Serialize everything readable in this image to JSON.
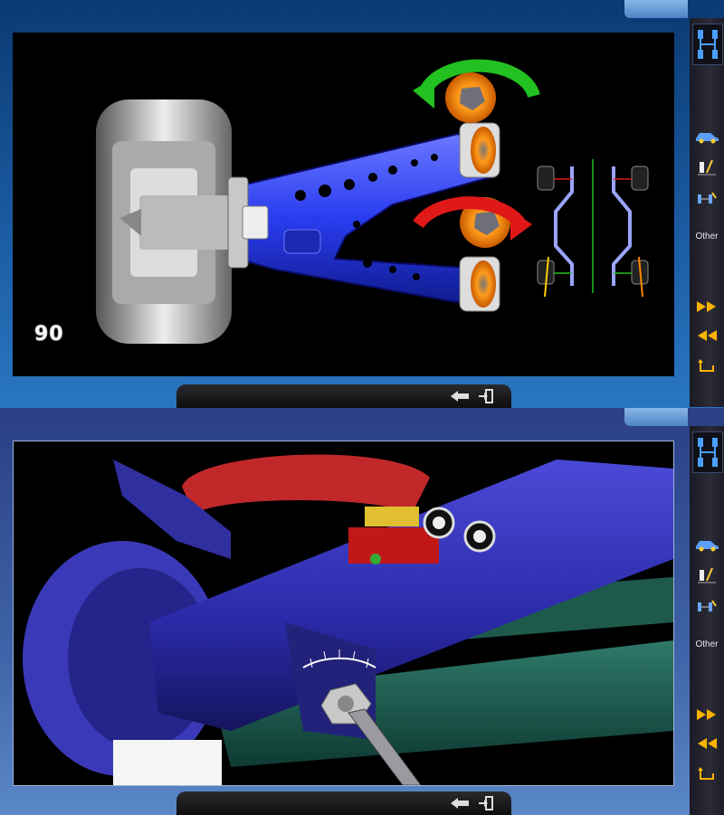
{
  "panels": [
    {
      "diagram": {
        "label": "90"
      },
      "sidebar": {
        "items": [
          {
            "icon": "wheel-alignment-icon"
          },
          {
            "icon": "car-icon"
          },
          {
            "icon": "camber-adjust-icon"
          },
          {
            "icon": "toe-adjust-icon"
          },
          {
            "label": "Other"
          },
          {
            "icon": "fast-forward-icon"
          },
          {
            "icon": "rewind-icon"
          },
          {
            "icon": "return-icon"
          }
        ]
      },
      "bottom_bar": {
        "buttons": [
          {
            "icon": "back-icon"
          },
          {
            "icon": "exit-icon"
          }
        ]
      }
    },
    {
      "sidebar": {
        "items": [
          {
            "icon": "wheel-alignment-icon"
          },
          {
            "icon": "car-icon"
          },
          {
            "icon": "camber-adjust-icon"
          },
          {
            "icon": "toe-adjust-icon"
          },
          {
            "label": "Other"
          },
          {
            "icon": "fast-forward-icon"
          },
          {
            "icon": "rewind-icon"
          },
          {
            "icon": "return-icon"
          }
        ]
      },
      "bottom_bar": {
        "buttons": [
          {
            "icon": "back-icon"
          },
          {
            "icon": "exit-icon"
          }
        ]
      }
    }
  ],
  "colors": {
    "panel_blue": "#1a5aa0",
    "arm_blue": "#2a3cf0",
    "arrow_green": "#22c020",
    "arrow_red": "#e01818",
    "sidebar_dark": "#24242e"
  }
}
